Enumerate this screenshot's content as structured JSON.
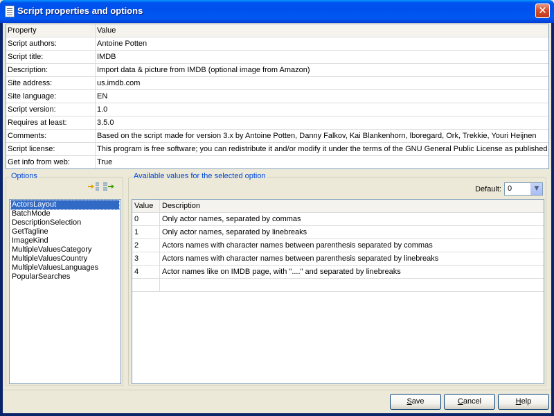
{
  "window": {
    "title": "Script properties and options"
  },
  "properties": {
    "header": {
      "property": "Property",
      "value": "Value"
    },
    "rows": [
      {
        "property": "Script authors:",
        "value": "Antoine Potten"
      },
      {
        "property": "Script title:",
        "value": "IMDB"
      },
      {
        "property": "Description:",
        "value": "Import data & picture from IMDB (optional image from Amazon)"
      },
      {
        "property": "Site address:",
        "value": "us.imdb.com"
      },
      {
        "property": "Site language:",
        "value": "EN"
      },
      {
        "property": "Script version:",
        "value": "1.0"
      },
      {
        "property": "Requires at least:",
        "value": "3.5.0"
      },
      {
        "property": "Comments:",
        "value": "Based on the script made for version 3.x by Antoine Potten, Danny Falkov, Kai Blankenhorn, lboregard, Ork, Trekkie, Youri Heijnen"
      },
      {
        "property": "Script license:",
        "value": "This program is free software; you can redistribute it and/or modify it under the terms of the GNU General Public License as published by"
      },
      {
        "property": "Get info from web:",
        "value": "True"
      }
    ]
  },
  "options": {
    "label": "Options",
    "items": [
      "ActorsLayout",
      "BatchMode",
      "DescriptionSelection",
      "GetTagline",
      "ImageKind",
      "MultipleValuesCategory",
      "MultipleValuesCountry",
      "MultipleValuesLanguages",
      "PopularSearches"
    ],
    "selected_index": 0
  },
  "values": {
    "label": "Available values for the selected option",
    "default_label": "Default:",
    "default_value": "0",
    "header": {
      "value": "Value",
      "description": "Description"
    },
    "rows": [
      {
        "value": "0",
        "description": "Only actor names, separated by commas"
      },
      {
        "value": "1",
        "description": "Only actor names, separated by linebreaks"
      },
      {
        "value": "2",
        "description": "Actors names with character names between parenthesis separated by commas"
      },
      {
        "value": "3",
        "description": "Actors names with character names between parenthesis separated by linebreaks"
      },
      {
        "value": "4",
        "description": "Actor names like on IMDB page, with \"....\" and separated by linebreaks"
      }
    ]
  },
  "buttons": {
    "save": {
      "underline": "S",
      "rest": "ave"
    },
    "cancel": {
      "underline": "C",
      "rest": "ancel"
    },
    "help": {
      "underline": "H",
      "rest": "elp"
    }
  },
  "colors": {
    "title_bar": "#0053ee",
    "selection": "#316ac5",
    "group_label": "#0046d5"
  }
}
